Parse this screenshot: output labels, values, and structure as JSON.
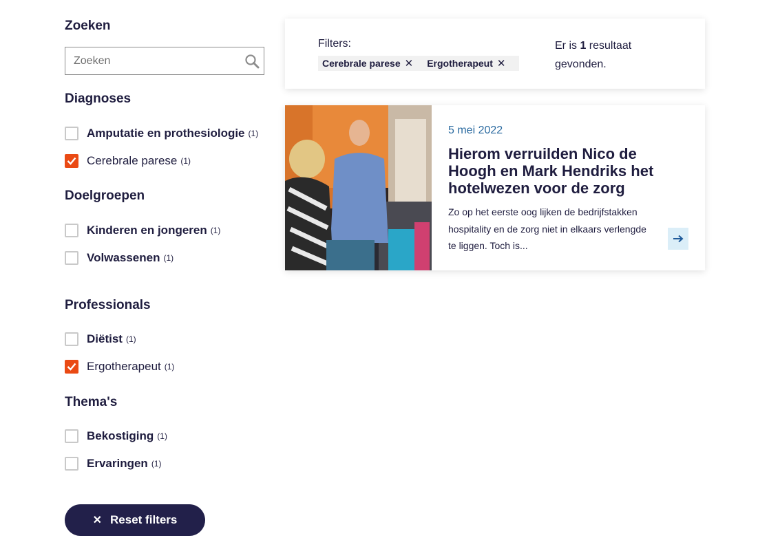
{
  "sidebar": {
    "search_title": "Zoeken",
    "search_placeholder": "Zoeken",
    "groups": [
      {
        "title": "Diagnoses",
        "options": [
          {
            "label": "Amputatie en prothesiologie",
            "count": "(1)",
            "checked": false
          },
          {
            "label": "Cerebrale parese",
            "count": "(1)",
            "checked": true
          }
        ]
      },
      {
        "title": "Doelgroepen",
        "options": [
          {
            "label": "Kinderen en jongeren",
            "count": "(1)",
            "checked": false
          },
          {
            "label": "Volwassenen",
            "count": "(1)",
            "checked": false
          }
        ]
      },
      {
        "title": "Professionals",
        "options": [
          {
            "label": "Diëtist",
            "count": "(1)",
            "checked": false
          },
          {
            "label": "Ergotherapeut",
            "count": "(1)",
            "checked": true
          }
        ]
      },
      {
        "title": "Thema's",
        "options": [
          {
            "label": "Bekostiging",
            "count": "(1)",
            "checked": false
          },
          {
            "label": "Ervaringen",
            "count": "(1)",
            "checked": false
          }
        ]
      }
    ],
    "reset_label": "Reset filters",
    "reset_icon": "close-icon"
  },
  "filterbar": {
    "label": "Filters:",
    "chips": [
      "Cerebrale parese",
      "Ergotherapeut"
    ],
    "result_prefix": "Er is ",
    "result_count": "1",
    "result_suffix": " resultaat gevonden."
  },
  "result": {
    "date": "5 mei 2022",
    "title": "Hierom verruilden Nico de Hoogh en Mark Hendriks het hotelwezen voor de zorg",
    "excerpt": "Zo op het eerste oog lijken de bedrijfstakken hospitality en de zorg niet in elkaars verlengde te liggen. Toch is...",
    "arrow_icon": "arrow-right-icon"
  },
  "colors": {
    "navy": "#1f1d3f",
    "accent_orange": "#ea4a14",
    "date_blue": "#2a6aa0",
    "arrow_bg": "#dbeef8"
  }
}
